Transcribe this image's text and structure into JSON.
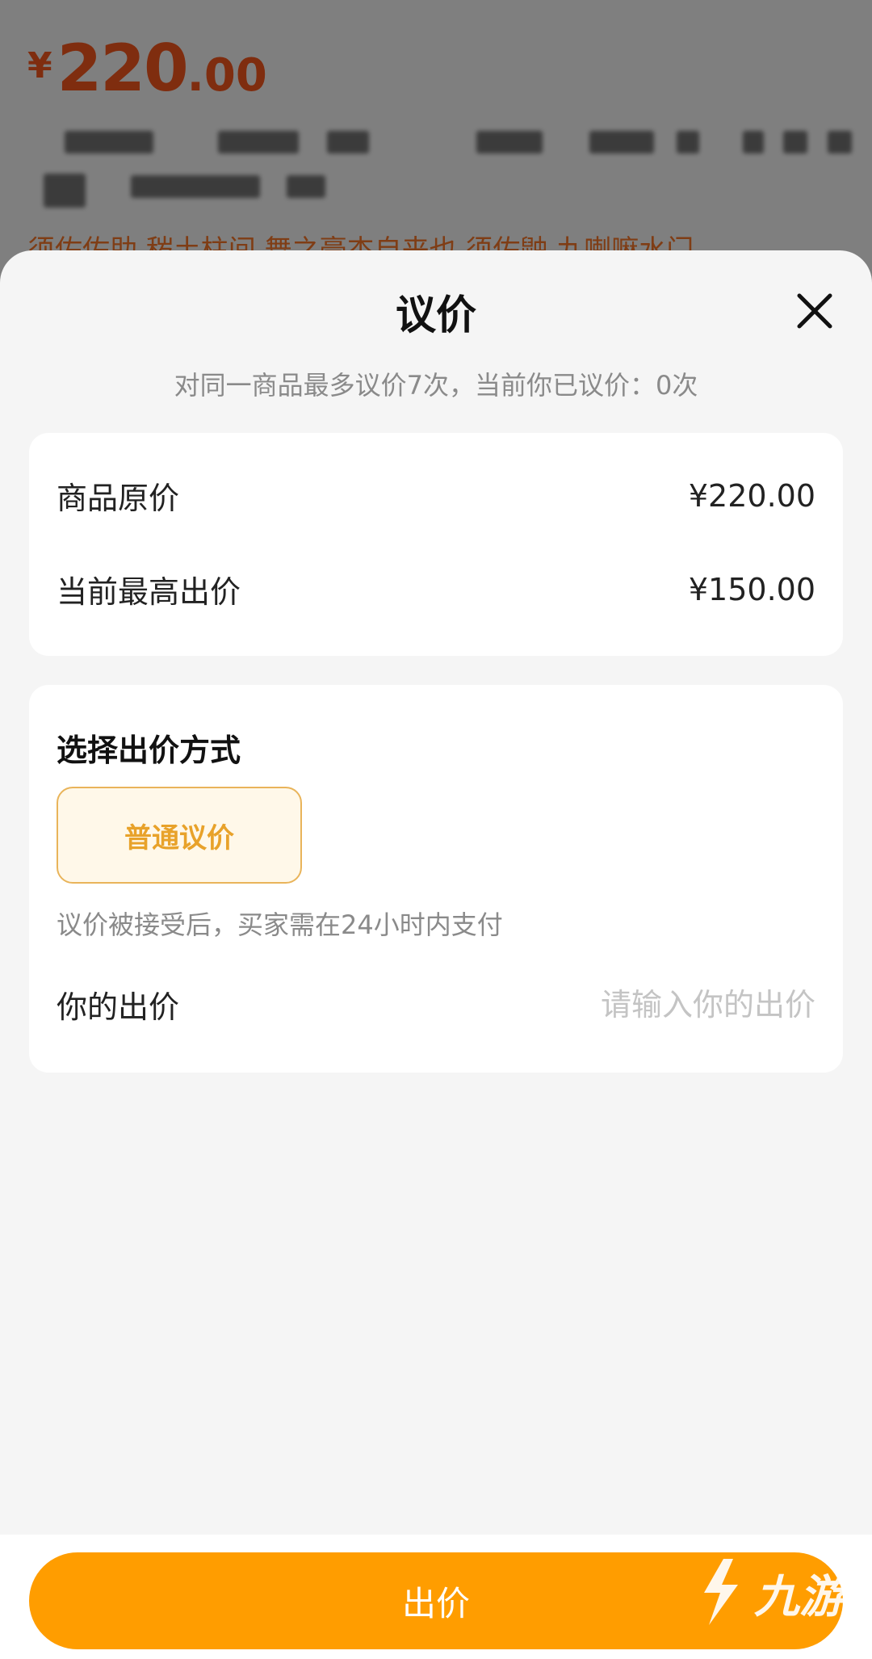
{
  "background_page": {
    "price_currency": "¥",
    "price_integer": "220",
    "price_decimal": ".00",
    "tags": "须佐佐助 秽土柱间 舞之豪杰自来也 须佐鼬 九喇嘛水门"
  },
  "sheet": {
    "title": "议价",
    "subtitle": "对同一商品最多议价7次，当前你已议价：0次",
    "price_info": {
      "original_price_label": "商品原价",
      "original_price_value": "¥220.00",
      "highest_bid_label": "当前最高出价",
      "highest_bid_value": "¥150.00"
    },
    "bid_method": {
      "section_title": "选择出价方式",
      "option_label": "普通议价",
      "hint": "议价被接受后，买家需在24小时内支付",
      "your_bid_label": "你的出价",
      "your_bid_placeholder": "请输入你的出价",
      "your_bid_value": ""
    }
  },
  "footer": {
    "submit_label": "出价",
    "watermark_text": "九游"
  },
  "colors": {
    "accent_orange": "#ff9d00",
    "price_red_orange": "#ff5a1f",
    "option_border": "#e9b45a",
    "option_text": "#e8a22a",
    "sheet_background": "#f5f5f5"
  }
}
